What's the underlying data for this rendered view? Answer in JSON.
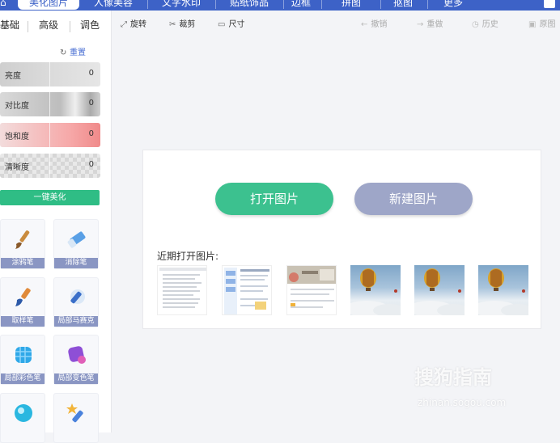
{
  "topnav": {
    "tabs": [
      "美化图片",
      "人像美容",
      "文字水印",
      "贴纸饰品",
      "边框",
      "拼图",
      "抠图",
      "更多"
    ]
  },
  "left": {
    "subtabs": [
      "基础",
      "高级",
      "调色"
    ],
    "reset": "重置",
    "sliders": [
      {
        "label": "亮度",
        "value": "0"
      },
      {
        "label": "对比度",
        "value": "0"
      },
      {
        "label": "饱和度",
        "value": "0"
      },
      {
        "label": "清晰度",
        "value": "0"
      }
    ],
    "one_key": "一键美化",
    "tools": [
      "涂鸦笔",
      "消除笔",
      "取样笔",
      "局部马赛克",
      "局部彩色笔",
      "局部变色笔"
    ]
  },
  "toolbar": {
    "rotate": "旋转",
    "crop": "裁剪",
    "size": "尺寸",
    "undo": "撤销",
    "redo": "重做",
    "history": "历史",
    "original": "原图"
  },
  "start": {
    "open": "打开图片",
    "new": "新建图片",
    "recent_title": "近期打开图片:"
  },
  "watermark": {
    "brand": "搜狗指南",
    "url": "zhinan.sogou.com"
  },
  "colors": {
    "nav": "#3d62c7",
    "open_button": "#3cc18f",
    "new_button": "#9ea6c8",
    "tool_label": "#8a96c3"
  }
}
